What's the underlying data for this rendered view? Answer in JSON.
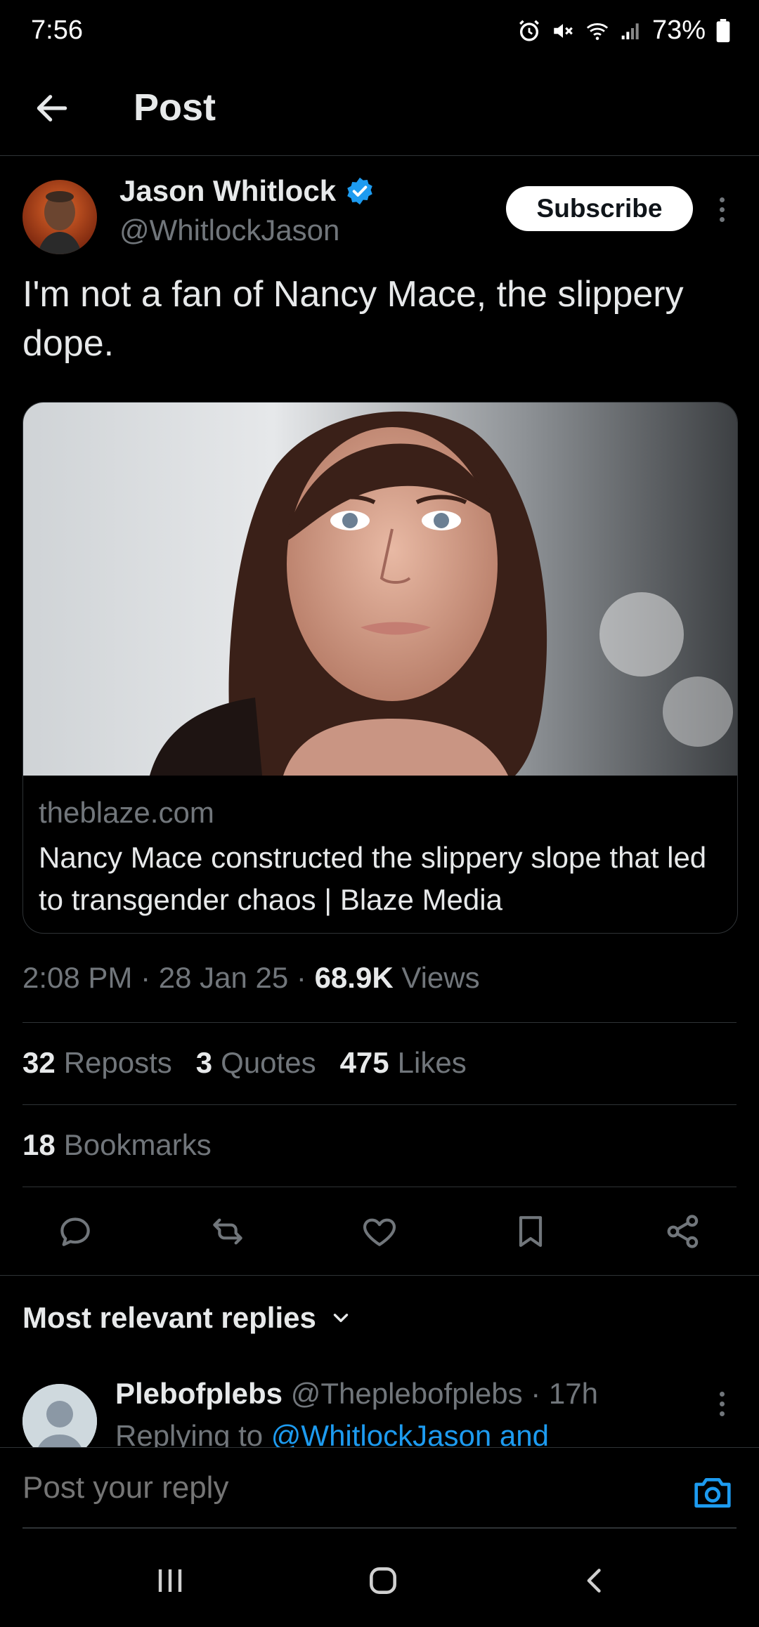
{
  "status_bar": {
    "time": "7:56",
    "battery": "73%"
  },
  "header": {
    "title": "Post"
  },
  "post": {
    "author_name": "Jason Whitlock",
    "author_handle": "@WhitlockJason",
    "subscribe_label": "Subscribe",
    "text": "I'm not a fan of Nancy Mace, the slippery dope.",
    "card": {
      "domain": "theblaze.com",
      "title": "Nancy Mace constructed the slippery slope that led to transgender chaos | Blaze Media"
    },
    "time": "2:08 PM",
    "date": "28 Jan 25",
    "views_count": "68.9K",
    "views_label": "Views",
    "reposts_count": "32",
    "reposts_label": "Reposts",
    "quotes_count": "3",
    "quotes_label": "Quotes",
    "likes_count": "475",
    "likes_label": "Likes",
    "bookmarks_count": "18",
    "bookmarks_label": "Bookmarks"
  },
  "replies": {
    "header": "Most relevant replies",
    "first": {
      "name": "Plebofplebs",
      "handle": "@Theplebofplebs",
      "time": "17h",
      "replying_prefix": "Replying to",
      "replying_to": "@WhitlockJason and"
    }
  },
  "reply_bar": {
    "placeholder": "Post your reply"
  },
  "colors": {
    "accent": "#1d9bf0",
    "background": "#000000",
    "muted": "#71767b"
  }
}
